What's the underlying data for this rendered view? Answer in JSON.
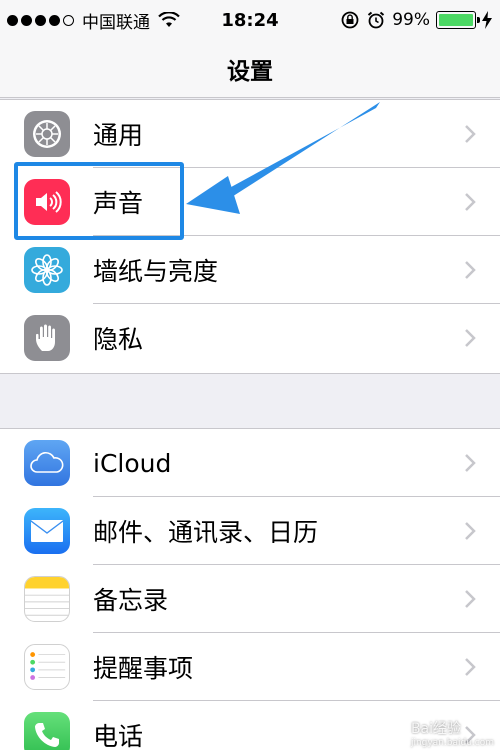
{
  "status_bar": {
    "carrier": "中国联通",
    "time": "18:24",
    "battery_percent": "99%",
    "battery_level": 0.99,
    "signal_bars_filled": 4,
    "signal_bars_total": 5
  },
  "nav": {
    "title": "设置"
  },
  "groups": [
    {
      "items": [
        {
          "label": "通用",
          "icon": "gear-icon",
          "icon_bg": "#8e8e93"
        },
        {
          "label": "声音",
          "icon": "speaker-icon",
          "icon_bg": "#ff2d55"
        },
        {
          "label": "墙纸与亮度",
          "icon": "flower-icon",
          "icon_bg": "#34aadc"
        },
        {
          "label": "隐私",
          "icon": "hand-icon",
          "icon_bg": "#8e8e93"
        }
      ]
    },
    {
      "items": [
        {
          "label": "iCloud",
          "icon": "cloud-icon",
          "icon_bg": "#3d8be8"
        },
        {
          "label": "邮件、通讯录、日历",
          "icon": "mail-icon",
          "icon_bg": "#1d8ff5"
        },
        {
          "label": "备忘录",
          "icon": "notes-icon",
          "icon_bg": "#ffffff"
        },
        {
          "label": "提醒事项",
          "icon": "reminders-icon",
          "icon_bg": "#ffffff"
        },
        {
          "label": "电话",
          "icon": "phone-icon",
          "icon_bg": "#4cd964"
        }
      ]
    }
  ],
  "colors": {
    "accent": "#1e88e5",
    "separator": "#c8c7cc",
    "background": "#efeff4"
  },
  "watermark": {
    "text": "Bai经验",
    "sub": "jingyan.baidu.com"
  }
}
